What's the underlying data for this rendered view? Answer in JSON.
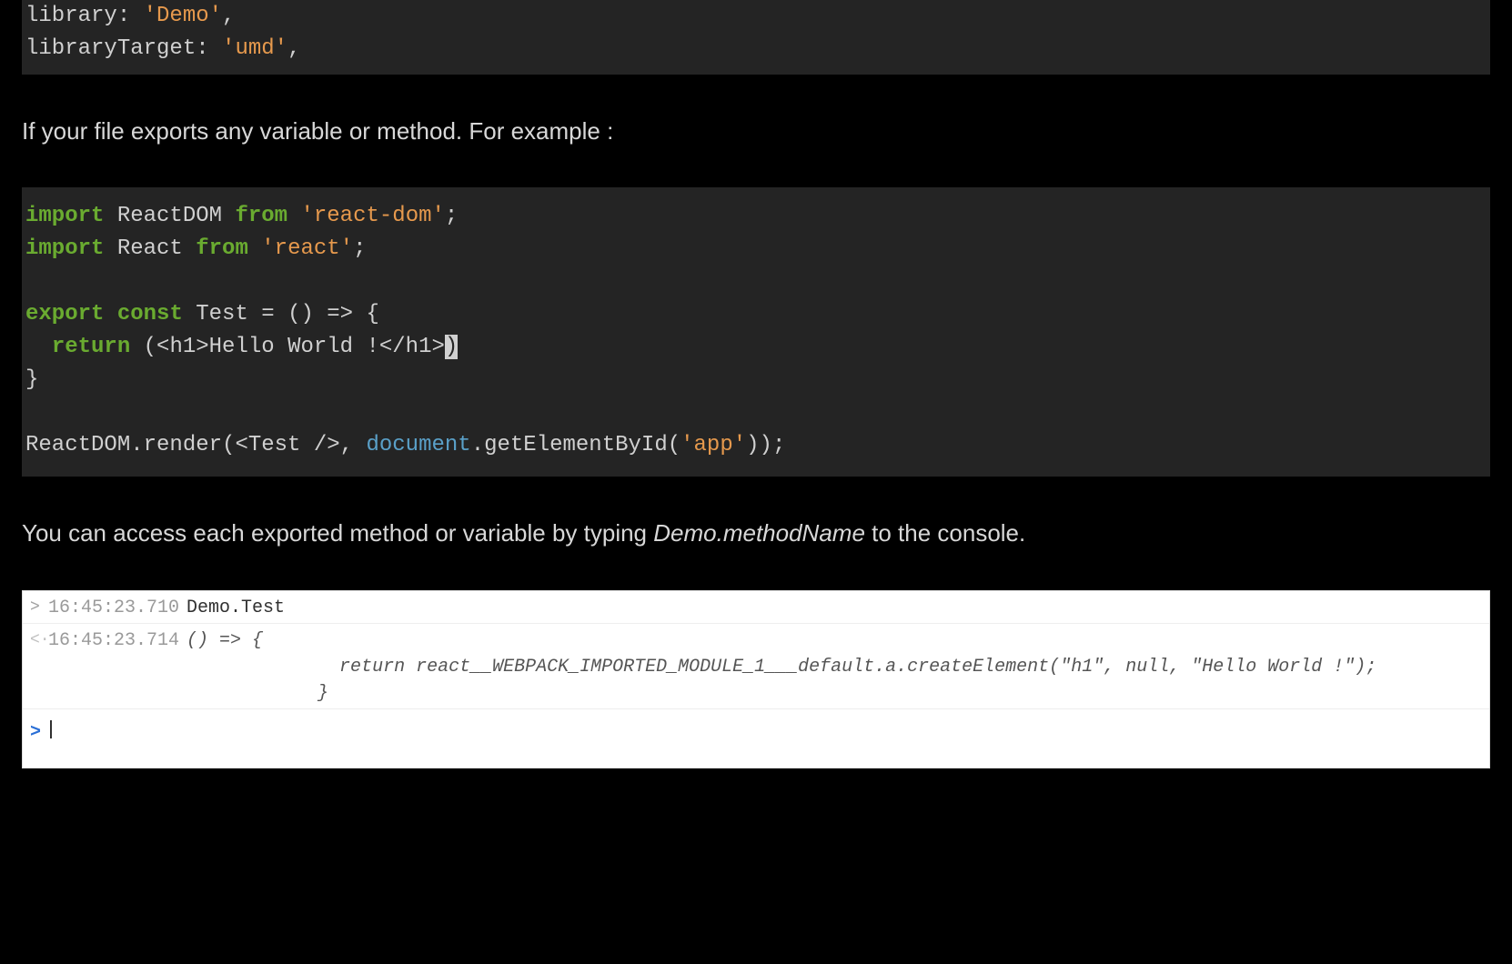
{
  "code1": {
    "l1_a": "library: ",
    "l1_b": "'Demo'",
    "l1_c": ",",
    "l2_a": "libraryTarget: ",
    "l2_b": "'umd'",
    "l2_c": ","
  },
  "prose1": "If your file exports any variable or method. For example :",
  "code2": {
    "l1_kw1": "import",
    "l1_a": " ReactDOM ",
    "l1_kw2": "from",
    "l1_b": " ",
    "l1_str": "'react-dom'",
    "l1_c": ";",
    "l2_kw1": "import",
    "l2_a": " React ",
    "l2_kw2": "from",
    "l2_b": " ",
    "l2_str": "'react'",
    "l2_c": ";",
    "blank": "",
    "l3_kw1": "export",
    "l3_sp1": " ",
    "l3_kw2": "const",
    "l3_a": " Test = () => {",
    "l4_sp": "  ",
    "l4_kw": "return",
    "l4_a": " (<h1>Hello World !</h1>",
    "l4_cur": ")",
    "l5": "}",
    "l6_a": "ReactDOM.render(<Test />, ",
    "l6_glob": "document",
    "l6_b": ".getElementById(",
    "l6_str": "'app'",
    "l6_c": "));"
  },
  "prose2_a": "You can access each exported method or variable by typing ",
  "prose2_i": "Demo.methodName",
  "prose2_b": " to the console.",
  "console": {
    "row1": {
      "arrow": ">",
      "ts": "16:45:23.710",
      "body": "Demo.Test"
    },
    "row2": {
      "arrow": "<·",
      "ts": "16:45:23.714",
      "body": "() => {\n              return react__WEBPACK_IMPORTED_MODULE_1___default.a.createElement(\"h1\", null, \"Hello World !\");\n            }"
    },
    "prompt": {
      "arrow": ">"
    }
  }
}
